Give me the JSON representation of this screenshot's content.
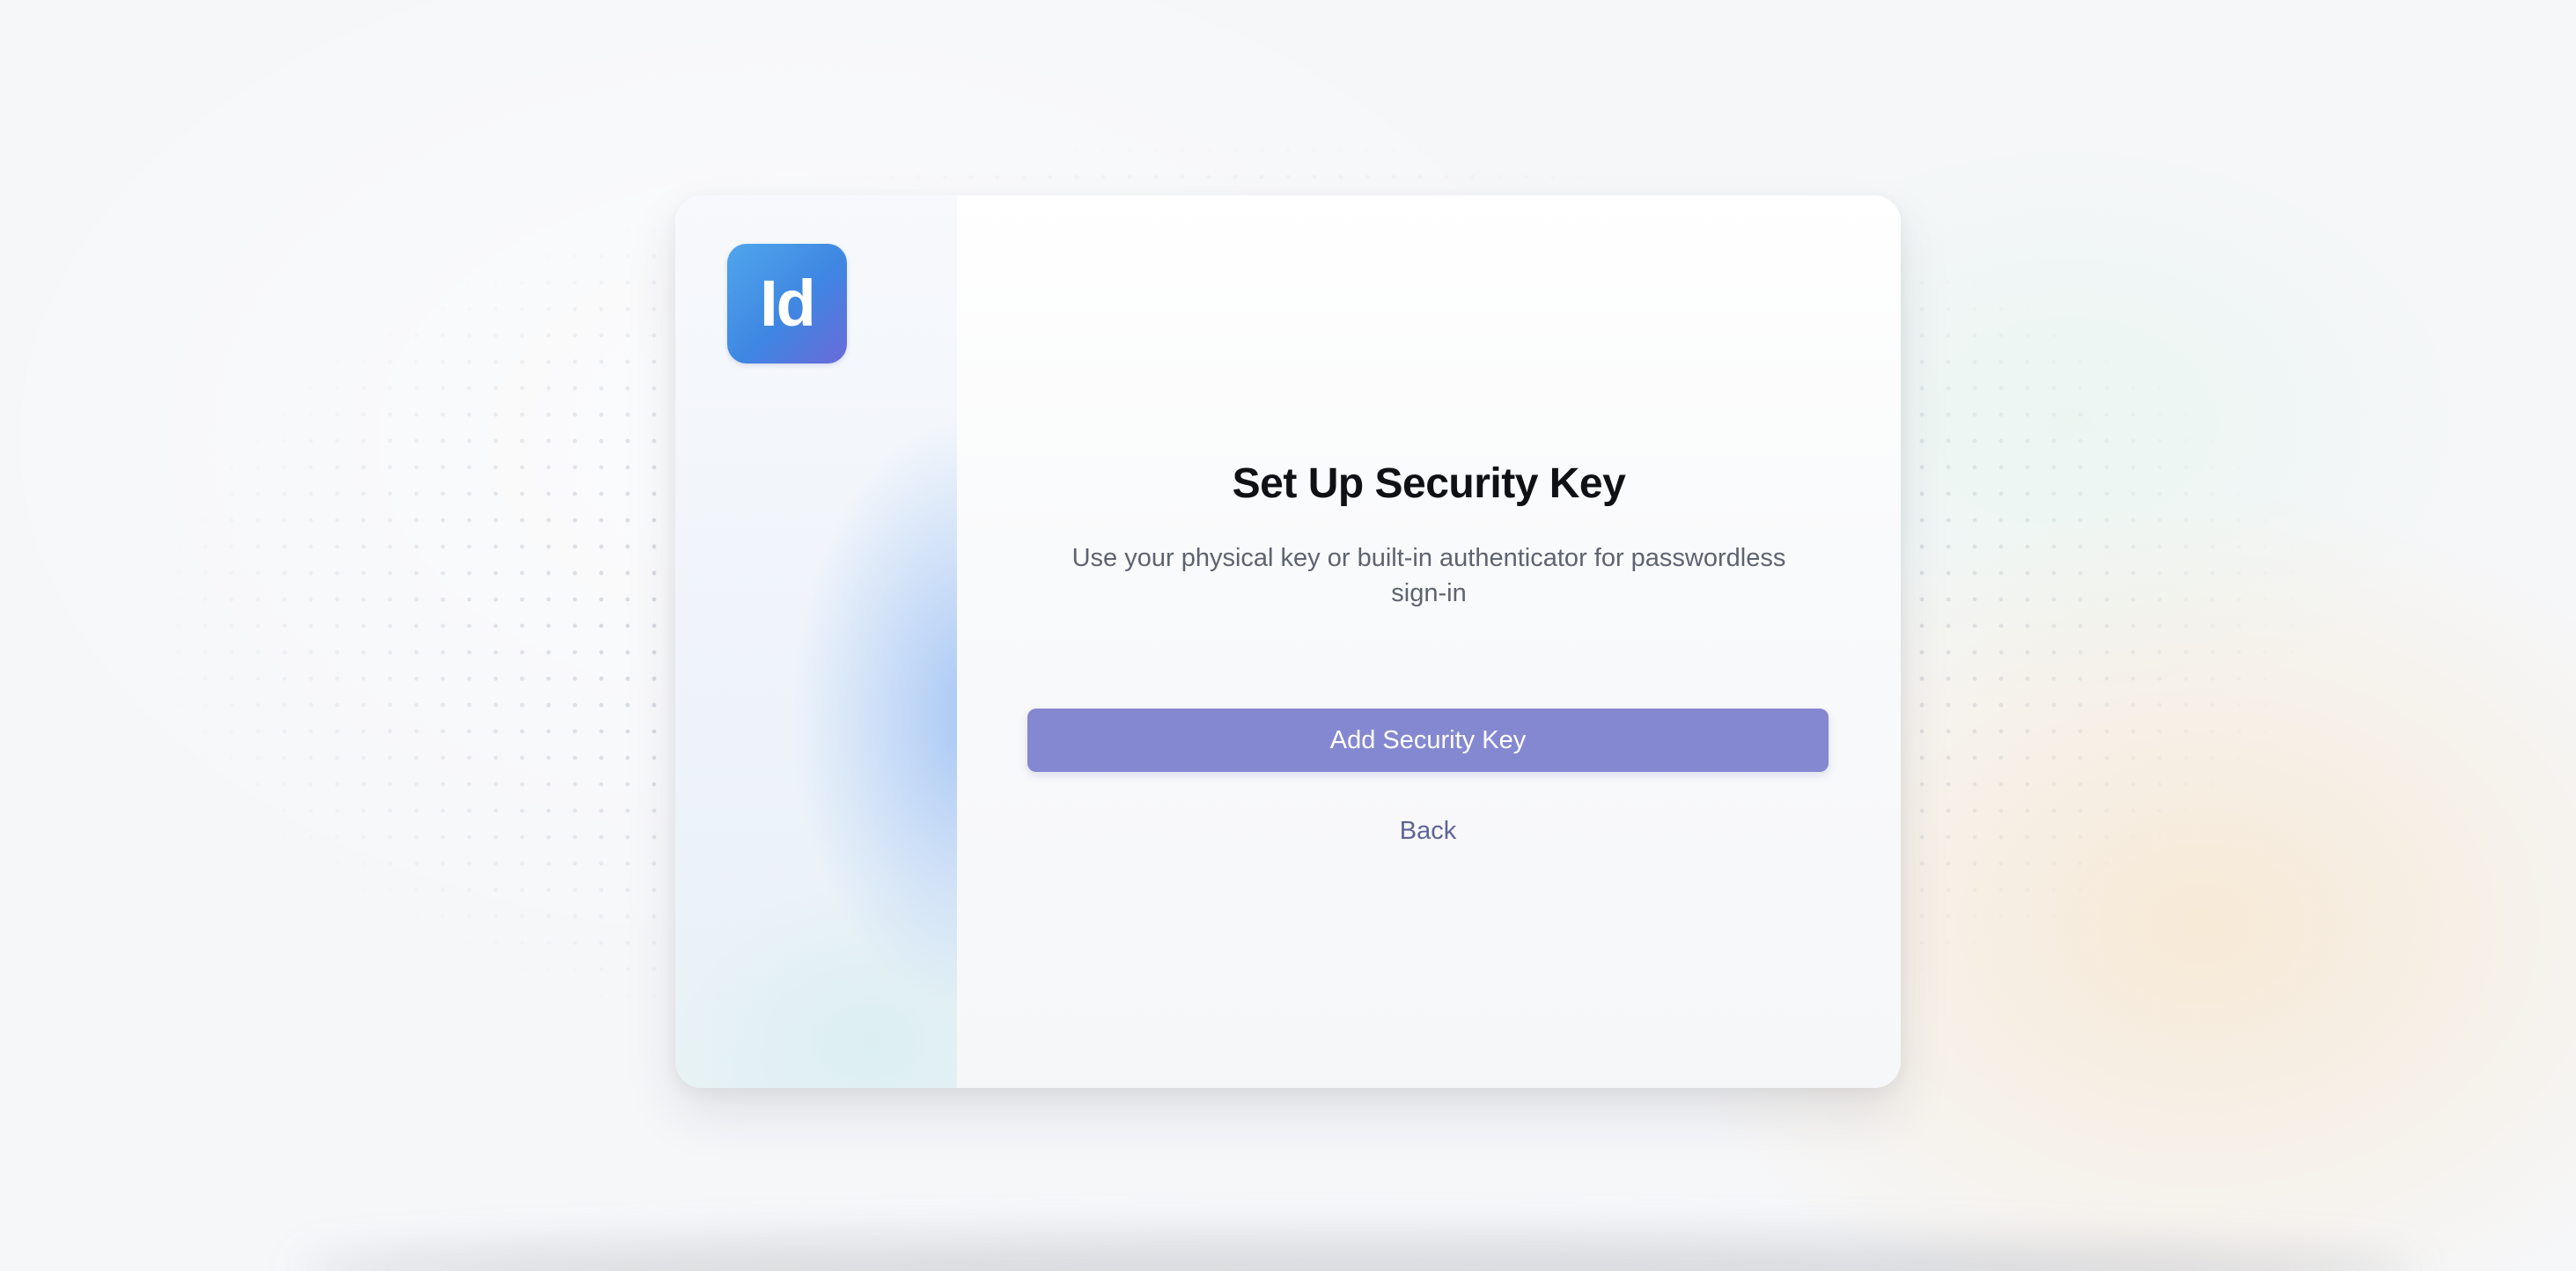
{
  "brand": {
    "logo_text": "Id",
    "logo_color": "#3f86e2"
  },
  "security_key_setup": {
    "title": "Set Up Security Key",
    "subtitle": "Use your physical key or built-in authenticator for passwordless sign-in",
    "primary_button_label": "Add Security Key",
    "back_label": "Back"
  },
  "colors": {
    "accent": "#8488d1",
    "link": "#5e6496",
    "title": "#0f1115",
    "subtitle": "#5d6370"
  }
}
